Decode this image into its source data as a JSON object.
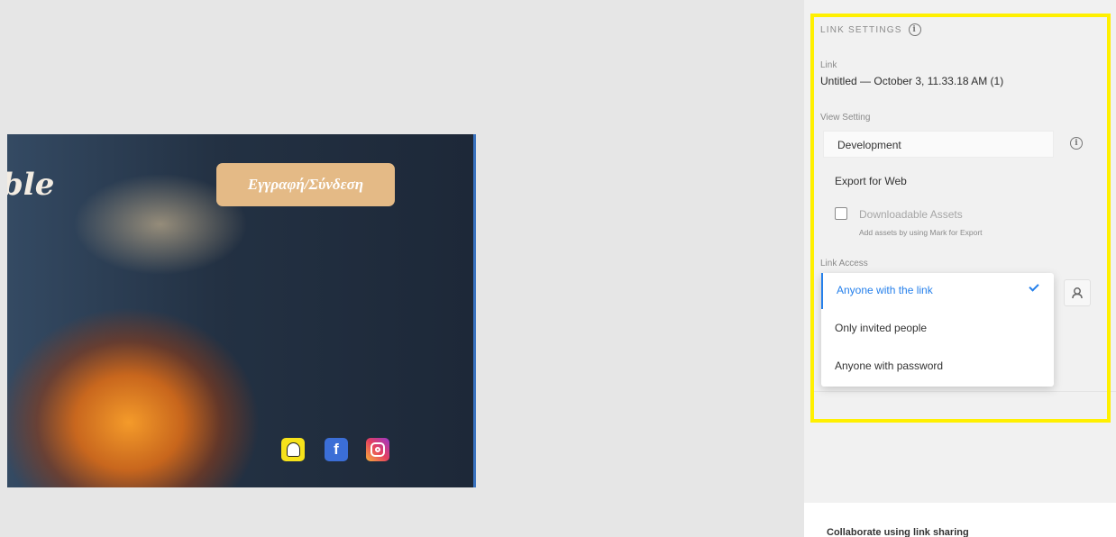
{
  "artboard": {
    "brand_text": "ble",
    "cta_label": "Εγγραφή/Σύνδεση",
    "social_icons": [
      "snapchat-icon",
      "facebook-icon",
      "instagram-icon"
    ],
    "facebook_glyph": "f"
  },
  "link_settings": {
    "title": "LINK SETTINGS",
    "link_label": "Link",
    "link_name": "Untitled — October 3, 11.33.18 AM (1)",
    "view_setting_label": "View Setting",
    "view_setting_value": "Development",
    "export_title": "Export for Web",
    "downloadable_assets_label": "Downloadable Assets",
    "downloadable_assets_hint": "Add assets by using Mark for Export",
    "link_access_label": "Link Access",
    "access_options": [
      {
        "label": "Anyone with the link",
        "selected": true
      },
      {
        "label": "Only invited people",
        "selected": false
      },
      {
        "label": "Anyone with password",
        "selected": false
      }
    ]
  },
  "collaborate": {
    "title": "Collaborate using link sharing"
  },
  "colors": {
    "accent": "#2680eb",
    "highlight": "#fff000",
    "cta": "#e4ba86"
  }
}
